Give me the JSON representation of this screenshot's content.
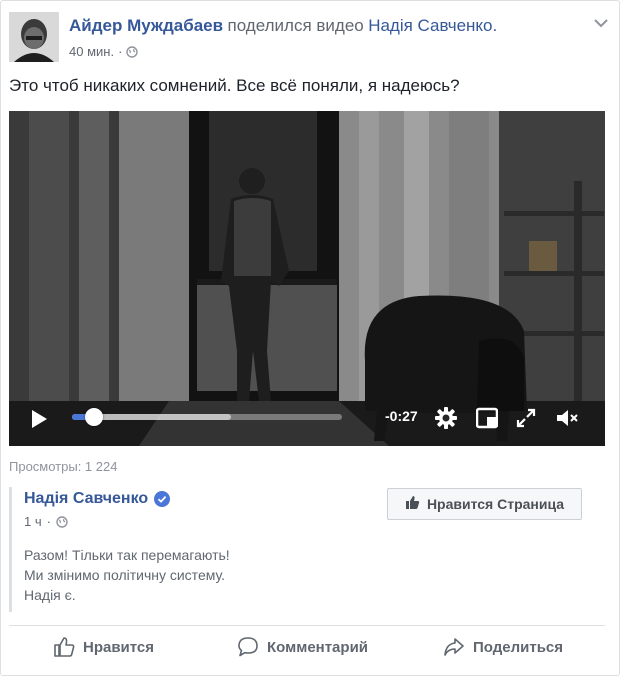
{
  "post": {
    "author": "Айдер Муждабаев",
    "action": "поделился видео",
    "shared_page": "Надія Савченко.",
    "time": "40 мин.",
    "separator": "·",
    "text": "Это чтоб никаких сомнений. Все всё поняли, я надеюсь?"
  },
  "video": {
    "time_remaining": "-0:27",
    "progress": 0.08,
    "buffered": 0.59
  },
  "views": "Просмотры: 1 224",
  "shared": {
    "name": "Надія Савченко",
    "time": "1 ч",
    "separator": "·",
    "like_page_label": "Нравится Страница",
    "lines": [
      "Разом! Тільки так перемагають!",
      "Ми змінимо політичну систему.",
      "Надія є."
    ]
  },
  "actions": {
    "like": "Нравится",
    "comment": "Комментарий",
    "share": "Поделиться"
  },
  "colors": {
    "link": "#365899",
    "accent": "#4a76d8"
  }
}
